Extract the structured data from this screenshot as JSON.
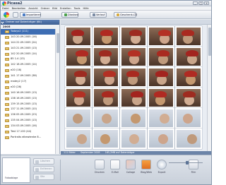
{
  "app": {
    "title": "Picasa2"
  },
  "window_controls": [
    "_",
    "□",
    "×"
  ],
  "menu": [
    "Datei",
    "Bearbeiten",
    "Ansicht",
    "Ordner",
    "Bild",
    "Erstellen",
    "Tools",
    "Hilfe"
  ],
  "toolbar": {
    "import_label": "Importieren",
    "slideshow_label": "Diashow",
    "timeline_label": "Verlauf",
    "gift_cd_label": "Geschenk-CD"
  },
  "left_panel": {
    "header": "Ordner auf Datenträger (64)",
    "year": "2005",
    "folders": [
      {
        "label": "Todays2 (111)",
        "selected": true
      },
      {
        "label": "143 20.09.2005 (16)"
      },
      {
        "label": "144 22.09.2005 (24)"
      },
      {
        "label": "143 21.09.2005 (13)"
      },
      {
        "label": "142 20.09.2005 (14)"
      },
      {
        "label": "85 1.4 (13)"
      },
      {
        "label": "142 18.09.2005 (14)"
      },
      {
        "label": "e20 (16)"
      },
      {
        "label": "141 17.09.2005 (38)"
      },
      {
        "label": "matey2 (17)"
      },
      {
        "label": "e20 (26)"
      },
      {
        "label": "140 16.09.2005 (13)"
      },
      {
        "label": "138 16.09.2005 (13)"
      },
      {
        "label": "139 15.09.2005 (13)"
      },
      {
        "label": "137 11.09.2005 (10)"
      },
      {
        "label": "136 05.09.2005 (23)"
      },
      {
        "label": "135 04.09.2005 (13)"
      },
      {
        "label": "134 03.09.2005 (16)"
      },
      {
        "label": "Test 17.100 (44)"
      },
      {
        "label": "Portraits eikewienke 8..."
      }
    ]
  },
  "status": {
    "count": "111 Bilder",
    "date": "September 2005",
    "size": "165,2MB auf Datenträger"
  },
  "tray": {
    "label": "Fotoablage",
    "buttons": [
      "Löschen",
      "Entfernen",
      "Sitz"
    ]
  },
  "tools": [
    "Drucken",
    "E-Mail",
    "Collage",
    "Blog/Web",
    "Export",
    "Film"
  ]
}
